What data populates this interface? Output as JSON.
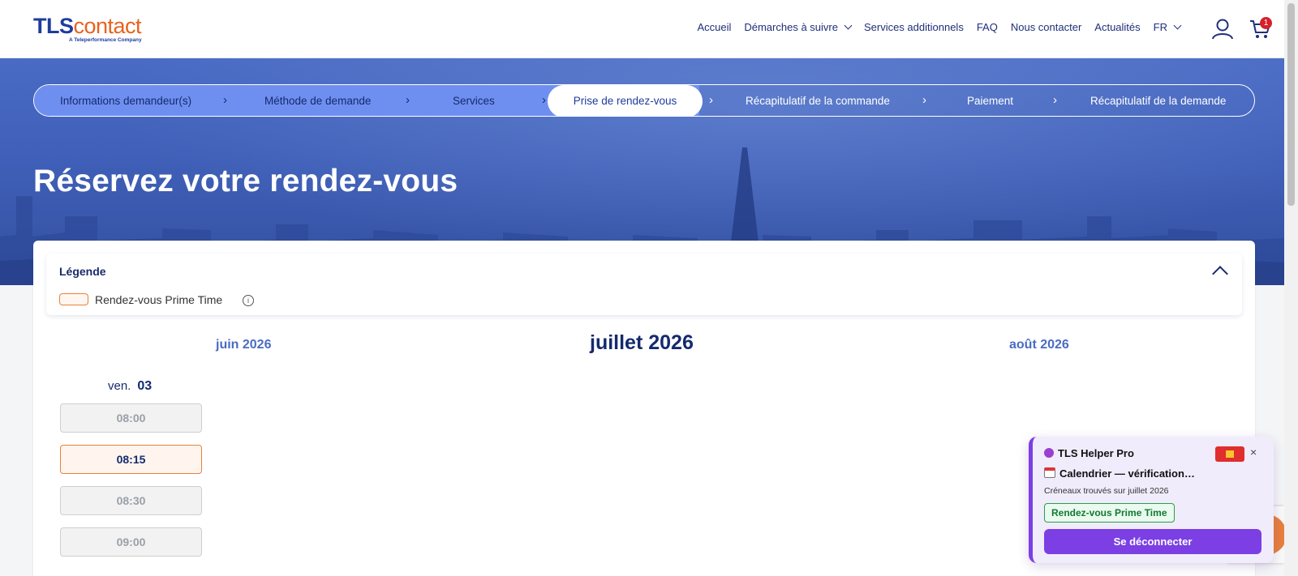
{
  "header": {
    "logo": {
      "tls": "TLS",
      "contact": "contact",
      "tagline": "A Teleperformance Company"
    },
    "nav": [
      {
        "label": "Accueil",
        "dropdown": false
      },
      {
        "label": "Démarches à suivre",
        "dropdown": true
      },
      {
        "label": "Services additionnels",
        "dropdown": false
      },
      {
        "label": "FAQ",
        "dropdown": false
      },
      {
        "label": "Nous contacter",
        "dropdown": false
      },
      {
        "label": "Actualités",
        "dropdown": false
      },
      {
        "label": "FR",
        "dropdown": true
      }
    ],
    "cart_count": "1"
  },
  "stepper": {
    "steps": [
      {
        "label": "Informations demandeur(s)",
        "state": "done"
      },
      {
        "label": "Méthode de demande",
        "state": "done"
      },
      {
        "label": "Services",
        "state": "done"
      },
      {
        "label": "Prise de rendez-vous",
        "state": "active"
      },
      {
        "label": "Récapitulatif de la commande",
        "state": "todo"
      },
      {
        "label": "Paiement",
        "state": "todo"
      },
      {
        "label": "Récapitulatif de la demande",
        "state": "todo"
      }
    ],
    "arrow_glyph": "›"
  },
  "hero": {
    "title": "Réservez votre rendez-vous"
  },
  "legend": {
    "title": "Légende",
    "item_label": "Rendez-vous Prime Time",
    "info_glyph": "i"
  },
  "calendar": {
    "prev_month": "juin 2026",
    "current_month": "juillet 2026",
    "next_month": "août 2026",
    "day": {
      "weekday": "ven.",
      "date": "03"
    },
    "slots": [
      {
        "time": "08:00",
        "state": "unavail"
      },
      {
        "time": "08:15",
        "state": "prime"
      },
      {
        "time": "08:30",
        "state": "unavail"
      },
      {
        "time": "09:00",
        "state": "unavail"
      }
    ]
  },
  "widget": {
    "title": "TLS Helper Pro",
    "close_glyph": "×",
    "status": "Calendrier — vérification…",
    "note": "Créneaux trouvés sur juillet 2026",
    "badge": "Rendez-vous Prime Time",
    "button": "Se déconnecter"
  },
  "colors": {
    "brand_blue": "#1f3c9c",
    "brand_orange": "#e8621e",
    "prime_border": "#e8813e",
    "widget_purple": "#7b3fe4"
  }
}
